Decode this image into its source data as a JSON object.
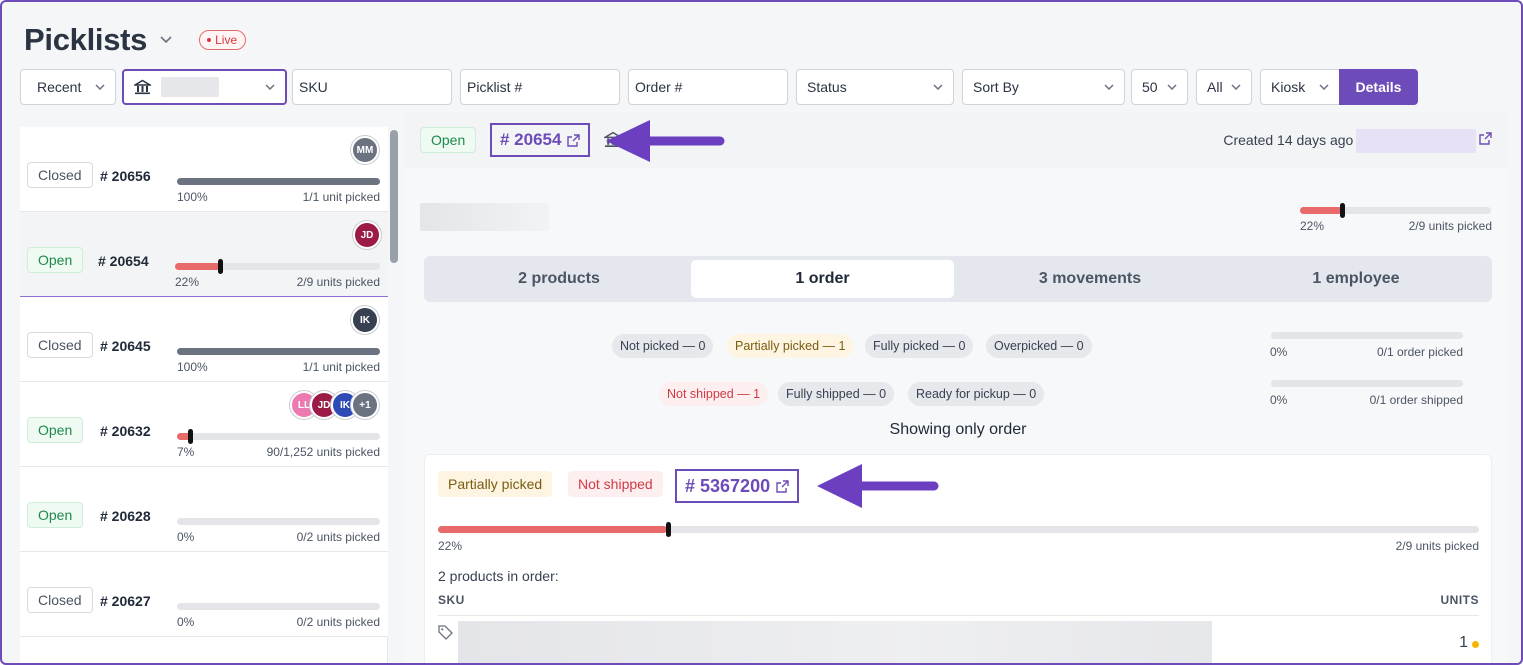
{
  "header": {
    "title": "Picklists",
    "live_label": "Live"
  },
  "filters": {
    "recent": "Recent",
    "sku_placeholder": "SKU",
    "picklist_placeholder": "Picklist #",
    "order_placeholder": "Order #",
    "status": "Status",
    "sort_by": "Sort By",
    "per_page": "50",
    "all": "All",
    "kiosk": "Kiosk",
    "details": "Details"
  },
  "picklists": [
    {
      "status": "Closed",
      "number": "# 20656",
      "percent": "100%",
      "units": "1/1 unit picked",
      "progress": 1.0,
      "avatars": [
        "MM"
      ]
    },
    {
      "status": "Open",
      "number": "# 20654",
      "percent": "22%",
      "units": "2/9 units picked",
      "progress": 0.22,
      "avatars": [
        "JD"
      ]
    },
    {
      "status": "Closed",
      "number": "# 20645",
      "percent": "100%",
      "units": "1/1 unit picked",
      "progress": 1.0,
      "avatars": [
        "IK"
      ]
    },
    {
      "status": "Open",
      "number": "# 20632",
      "percent": "7%",
      "units": "90/1,252 units picked",
      "progress": 0.07,
      "avatars": [
        "LL",
        "JD",
        "IK",
        "+1"
      ]
    },
    {
      "status": "Open",
      "number": "# 20628",
      "percent": "0%",
      "units": "0/2 units picked",
      "progress": 0,
      "avatars": []
    },
    {
      "status": "Closed",
      "number": "# 20627",
      "percent": "0%",
      "units": "0/2 units picked",
      "progress": 0,
      "avatars": []
    }
  ],
  "detail": {
    "status": "Open",
    "number": "# 20654",
    "created": "Created 14 days ago by",
    "percent": "22%",
    "units": "2/9 units picked",
    "progress": 0.22,
    "tabs": [
      "2 products",
      "1 order",
      "3 movements",
      "1 employee"
    ],
    "active_tab": 1,
    "pick_chips": [
      "Not picked — 0",
      "Partially picked — 1",
      "Fully picked — 0",
      "Overpicked — 0"
    ],
    "ship_chips": [
      "Not shipped — 1",
      "Fully shipped — 0",
      "Ready for pickup — 0"
    ],
    "order_picked": {
      "percent": "0%",
      "label": "0/1 order picked"
    },
    "order_shipped": {
      "percent": "0%",
      "label": "0/1 order shipped"
    },
    "showing": "Showing only order"
  },
  "order": {
    "pick_status": "Partially picked",
    "ship_status": "Not shipped",
    "number": "# 5367200",
    "percent": "22%",
    "units": "2/9 units picked",
    "progress": 0.22,
    "products_heading": "2 products in order:",
    "col_sku": "SKU",
    "col_units": "UNITS",
    "row_units": "1"
  },
  "colors": {
    "accent": "#6d4bb8",
    "progress_red": "#e86a6a",
    "progress_grey": "#6b7280",
    "units_dot": "#f5b400"
  }
}
